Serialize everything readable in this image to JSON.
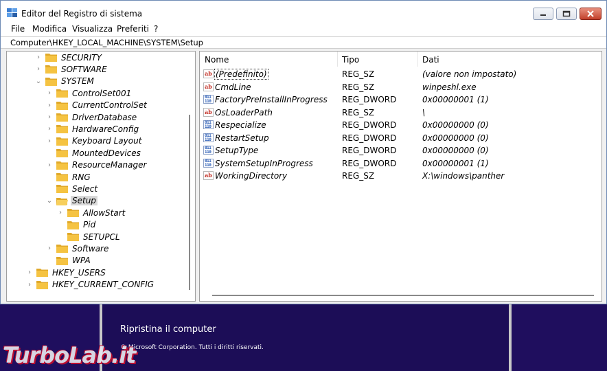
{
  "window": {
    "title": "Editor del Registro di sistema",
    "controls": [
      "minimize",
      "maximize",
      "close"
    ]
  },
  "menu": [
    "File",
    "Modifica",
    "Visualizza",
    "Preferiti",
    "?"
  ],
  "address": "Computer\\HKEY_LOCAL_MACHINE\\SYSTEM\\Setup",
  "tree": [
    {
      "label": "SECURITY",
      "chevron": "›"
    },
    {
      "label": "SOFTWARE",
      "chevron": "›"
    },
    {
      "label": "SYSTEM",
      "chevron": "⌄"
    },
    {
      "label": "ControlSet001",
      "chevron": "›"
    },
    {
      "label": "CurrentControlSet",
      "chevron": "›"
    },
    {
      "label": "DriverDatabase",
      "chevron": "›"
    },
    {
      "label": "HardwareConfig",
      "chevron": "›"
    },
    {
      "label": "Keyboard Layout",
      "chevron": "›"
    },
    {
      "label": "MountedDevices",
      "chevron": ""
    },
    {
      "label": "ResourceManager",
      "chevron": "›"
    },
    {
      "label": "RNG",
      "chevron": ""
    },
    {
      "label": "Select",
      "chevron": ""
    },
    {
      "label": "Setup",
      "chevron": "⌄",
      "selected": true
    },
    {
      "label": "AllowStart",
      "chevron": "›"
    },
    {
      "label": "Pid",
      "chevron": ""
    },
    {
      "label": "SETUPCL",
      "chevron": ""
    },
    {
      "label": "Software",
      "chevron": "›"
    },
    {
      "label": "WPA",
      "chevron": ""
    },
    {
      "label": "HKEY_USERS",
      "chevron": "›"
    },
    {
      "label": "HKEY_CURRENT_CONFIG",
      "chevron": "›"
    }
  ],
  "columns": {
    "name": "Nome",
    "type": "Tipo",
    "data": "Dati"
  },
  "values": [
    {
      "name": "(Predefinito)",
      "type": "REG_SZ",
      "data": "(valore non impostato)",
      "icon": "string-value-icon"
    },
    {
      "name": "CmdLine",
      "type": "REG_SZ",
      "data": "winpeshl.exe",
      "icon": "string-value-icon"
    },
    {
      "name": "FactoryPreInstallInProgress",
      "type": "REG_DWORD",
      "data": "0x00000001 (1)",
      "icon": "binary-value-icon"
    },
    {
      "name": "OsLoaderPath",
      "type": "REG_SZ",
      "data": "\\",
      "icon": "string-value-icon"
    },
    {
      "name": "Respecialize",
      "type": "REG_DWORD",
      "data": "0x00000000 (0)",
      "icon": "binary-value-icon"
    },
    {
      "name": "RestartSetup",
      "type": "REG_DWORD",
      "data": "0x00000000 (0)",
      "icon": "binary-value-icon"
    },
    {
      "name": "SetupType",
      "type": "REG_DWORD",
      "data": "0x00000000 (0)",
      "icon": "binary-value-icon"
    },
    {
      "name": "SystemSetupInProgress",
      "type": "REG_DWORD",
      "data": "0x00000001 (1)",
      "icon": "binary-value-icon"
    },
    {
      "name": "WorkingDirectory",
      "type": "REG_SZ",
      "data": "X:\\windows\\panther",
      "icon": "string-value-icon"
    }
  ],
  "icon_labels": {
    "string": "ab",
    "binary": "011\n110"
  },
  "background": {
    "restore_link": "Ripristina il computer",
    "copyright": "© Microsoft Corporation. Tutti i diritti riservati."
  },
  "watermark": "TurboLab.it",
  "colors": {
    "folder": "#f5c342",
    "selection": "#d9d9d9",
    "setup_background": "#1f0e5e",
    "close_button": "#c2402b"
  }
}
